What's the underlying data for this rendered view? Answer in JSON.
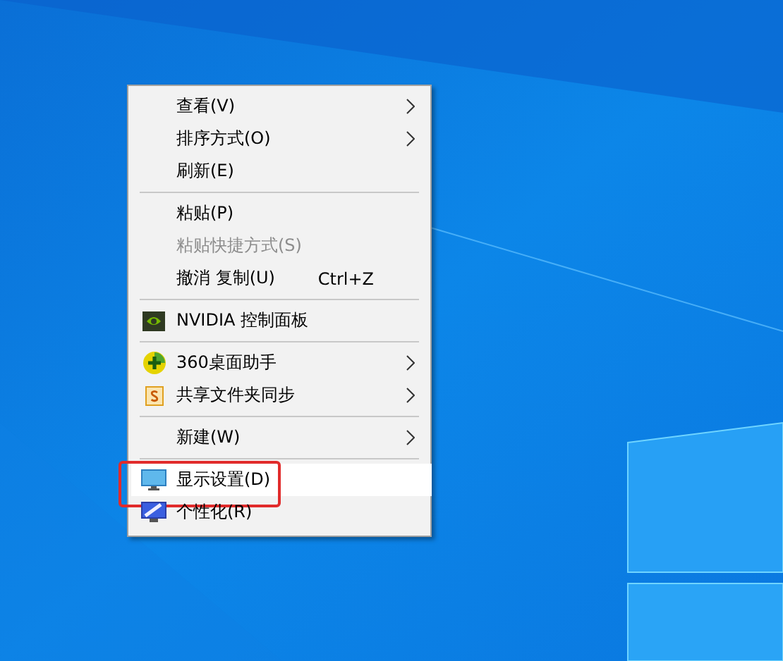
{
  "context_menu": {
    "items": [
      {
        "kind": "item",
        "label": "查看(V)",
        "submenu": true,
        "disabled": false,
        "selected": false
      },
      {
        "kind": "item",
        "label": "排序方式(O)",
        "submenu": true,
        "disabled": false,
        "selected": false
      },
      {
        "kind": "item",
        "label": "刷新(E)",
        "submenu": false,
        "disabled": false,
        "selected": false
      },
      {
        "kind": "separator"
      },
      {
        "kind": "item",
        "label": "粘贴(P)",
        "submenu": false,
        "disabled": false,
        "selected": false
      },
      {
        "kind": "item",
        "label": "粘贴快捷方式(S)",
        "submenu": false,
        "disabled": true,
        "selected": false
      },
      {
        "kind": "item",
        "label": "撤消 复制(U)",
        "shortcut": "Ctrl+Z",
        "submenu": false,
        "disabled": false,
        "selected": false
      },
      {
        "kind": "separator"
      },
      {
        "kind": "item",
        "label": "NVIDIA 控制面板",
        "submenu": false,
        "disabled": false,
        "selected": false
      },
      {
        "kind": "separator"
      },
      {
        "kind": "item",
        "label": "360桌面助手",
        "submenu": true,
        "disabled": false,
        "selected": false
      },
      {
        "kind": "item",
        "label": "共享文件夹同步",
        "submenu": true,
        "disabled": false,
        "selected": false
      },
      {
        "kind": "separator"
      },
      {
        "kind": "item",
        "label": "新建(W)",
        "submenu": true,
        "disabled": false,
        "selected": false
      },
      {
        "kind": "separator"
      },
      {
        "kind": "item",
        "label": "显示设置(D)",
        "submenu": false,
        "disabled": false,
        "selected": true,
        "annotated": true
      },
      {
        "kind": "item",
        "label": "个性化(R)",
        "submenu": false,
        "disabled": false,
        "selected": false
      }
    ]
  }
}
